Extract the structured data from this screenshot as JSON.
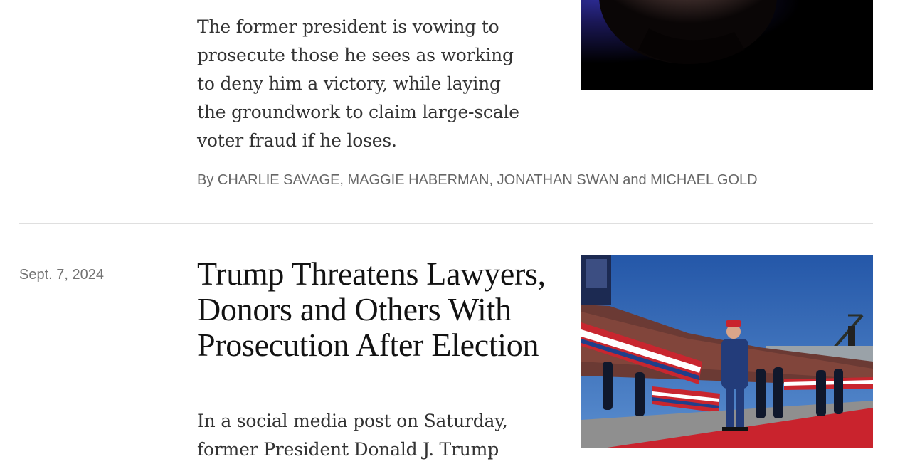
{
  "story_top": {
    "summary": "The former president is vowing to prosecute those he sees as working to deny him a victory, while laying the groundwork to claim large-scale voter fraud if he loses.",
    "byline": "By CHARLIE SAVAGE, MAGGIE HABERMAN, JONATHAN SWAN and MICHAEL GOLD"
  },
  "story_second": {
    "date": "Sept. 7, 2024",
    "headline": "Trump Threatens Lawyers, Donors and Others With Prosecution After Election",
    "summary": "In a social media post on Saturday, former President Donald J. Trump"
  },
  "colors": {
    "headline": "#121212",
    "body_text": "#333333",
    "meta_text": "#666666",
    "divider": "#dfdfdf"
  }
}
